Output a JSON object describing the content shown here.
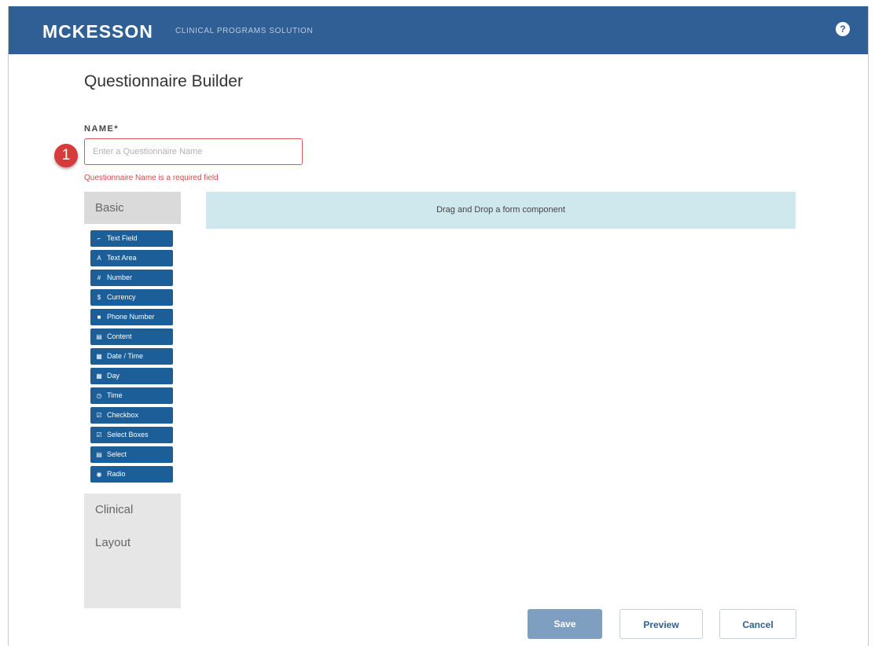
{
  "header": {
    "logo": "MCKESSON",
    "subtitle": "CLINICAL PROGRAMS SOLUTION",
    "help_glyph": "?"
  },
  "page": {
    "title": "Questionnaire Builder",
    "name_label": "NAME*",
    "name_placeholder": "Enter a Questionnaire Name",
    "name_value": "",
    "error": "Questionnaire Name is a required field",
    "marker": "1"
  },
  "sidebar": {
    "basic": "Basic",
    "components": [
      {
        "label": "Text Field",
        "icon": "text-field-icon",
        "glyph": "⌐"
      },
      {
        "label": "Text Area",
        "icon": "text-area-icon",
        "glyph": "A"
      },
      {
        "label": "Number",
        "icon": "number-icon",
        "glyph": "#"
      },
      {
        "label": "Currency",
        "icon": "currency-icon",
        "glyph": "$"
      },
      {
        "label": "Phone Number",
        "icon": "phone-icon",
        "glyph": "■"
      },
      {
        "label": "Content",
        "icon": "content-icon",
        "glyph": "▤"
      },
      {
        "label": "Date / Time",
        "icon": "calendar-icon",
        "glyph": "▦"
      },
      {
        "label": "Day",
        "icon": "calendar-icon",
        "glyph": "▦"
      },
      {
        "label": "Time",
        "icon": "clock-icon",
        "glyph": "◷"
      },
      {
        "label": "Checkbox",
        "icon": "checkbox-icon",
        "glyph": "☑"
      },
      {
        "label": "Select Boxes",
        "icon": "select-boxes-icon",
        "glyph": "☑"
      },
      {
        "label": "Select",
        "icon": "select-icon",
        "glyph": "▤"
      },
      {
        "label": "Radio",
        "icon": "radio-icon",
        "glyph": "◉"
      }
    ],
    "clinical": "Clinical",
    "layout": "Layout"
  },
  "dropzone": {
    "text": "Drag and Drop a form component"
  },
  "buttons": {
    "save": "Save",
    "preview": "Preview",
    "cancel": "Cancel"
  },
  "colors": {
    "header_bg": "#2f5f94",
    "component_bg": "#1b5e98",
    "error": "#d94848",
    "dropzone_bg": "#cfe8ee"
  }
}
